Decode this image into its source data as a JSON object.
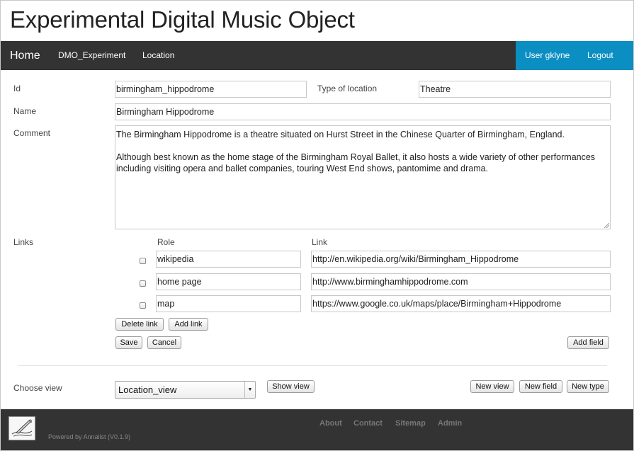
{
  "header": {
    "title": "Experimental Digital Music Object"
  },
  "nav": {
    "home": "Home",
    "dmo_experiment": "DMO_Experiment",
    "location": "Location",
    "user": "User gklyne",
    "logout": "Logout"
  },
  "form": {
    "id_label": "Id",
    "id_value": "birmingham_hippodrome",
    "type_label": "Type of location",
    "type_value": "Theatre",
    "name_label": "Name",
    "name_value": "Birmingham Hippodrome",
    "comment_label": "Comment",
    "comment_value": "The Birmingham Hippodrome is a theatre situated on Hurst Street in the Chinese Quarter of Birmingham, England.\n\nAlthough best known as the home stage of the Birmingham Royal Ballet, it also hosts a wide variety of other performances including visiting opera and ballet companies, touring West End shows, pantomime and drama.",
    "links_label": "Links",
    "role_header": "Role",
    "link_header": "Link",
    "links": [
      {
        "role": "wikipedia",
        "url": "http://en.wikipedia.org/wiki/Birmingham_Hippodrome"
      },
      {
        "role": "home page",
        "url": "http://www.birminghamhippodrome.com"
      },
      {
        "role": "map",
        "url": "https://www.google.co.uk/maps/place/Birmingham+Hippodrome"
      }
    ],
    "delete_link": "Delete link",
    "add_link": "Add link",
    "save": "Save",
    "cancel": "Cancel",
    "add_field": "Add field"
  },
  "view": {
    "choose_label": "Choose view",
    "selected": "Location_view",
    "show_view": "Show view",
    "new_view": "New view",
    "new_field": "New field",
    "new_type": "New type"
  },
  "footer": {
    "about": "About",
    "contact": "Contact",
    "sitemap": "Sitemap",
    "admin": "Admin",
    "powered": "Powered by Annalist (V0.1.9)"
  },
  "colors": {
    "navbar": "#333333",
    "user_area": "#0b8ec2",
    "footer": "#333333"
  }
}
